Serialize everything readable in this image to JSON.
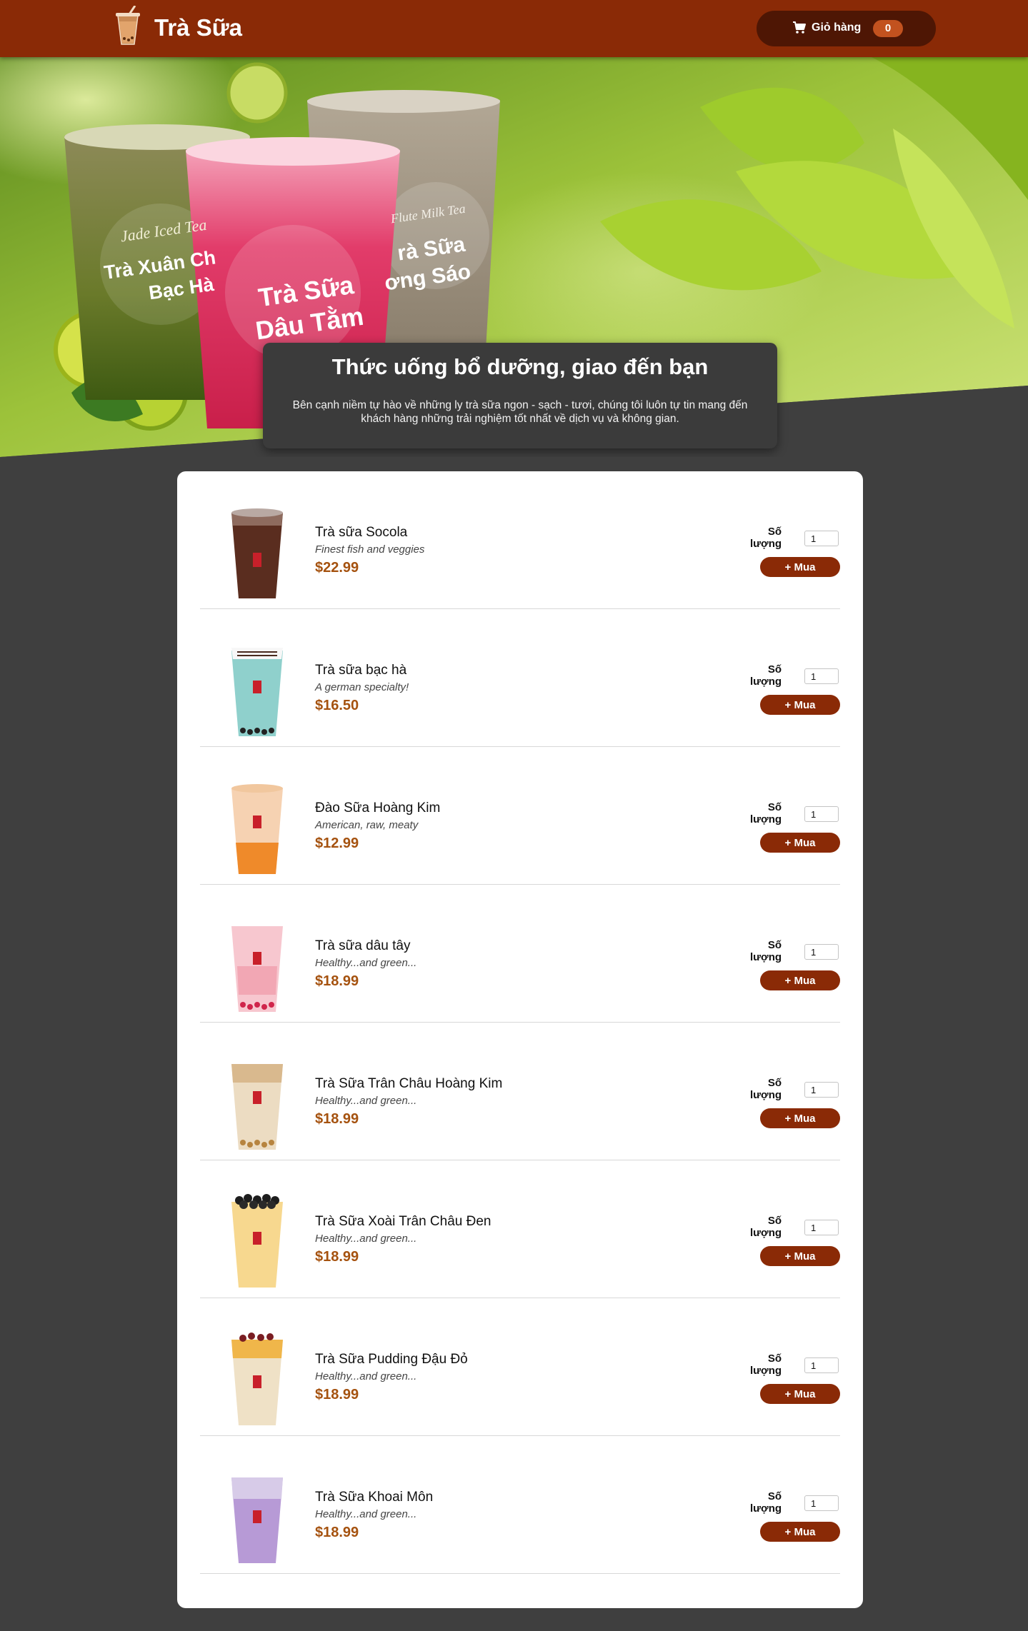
{
  "header": {
    "brand": "Trà Sữa",
    "cart_label": "Giỏ hàng",
    "cart_count": "0"
  },
  "hero": {
    "title": "Thức uống bổ dưỡng, giao đến bạn",
    "description": "Bên cạnh niềm tự hào về những ly trà sữa ngon - sạch - tươi, chúng tôi luôn tự tin mang đến khách hàng những trải nghiệm tốt nhất về dịch vụ và không gian.",
    "image_cups": [
      {
        "line1": "Jade Iced Tea",
        "line2": "Trà Xuân Ch",
        "line3": "Bạc Hà"
      },
      {
        "line1": "Trà Sữa",
        "line2": "Dâu Tằm"
      },
      {
        "line1": "Flute Milk Tea",
        "line2": "rà Sữa",
        "line3": "ơng Sáo"
      }
    ]
  },
  "products": [
    {
      "name": "Trà sữa Socola",
      "desc": "Finest fish and veggies",
      "price": "$22.99",
      "qty_label": "Số lượng",
      "qty": "1",
      "buy_label": "+ Mua",
      "color": "#5a2d1f"
    },
    {
      "name": "Trà sữa bạc hà",
      "desc": "A german specialty!",
      "price": "$16.50",
      "qty_label": "Số lượng",
      "qty": "1",
      "buy_label": "+ Mua",
      "color": "#8fd0cc"
    },
    {
      "name": "Đào Sữa Hoàng Kim",
      "desc": "American, raw, meaty",
      "price": "$12.99",
      "qty_label": "Số lượng",
      "qty": "1",
      "buy_label": "+ Mua",
      "color": "#f0a060"
    },
    {
      "name": "Trà sữa dâu tây",
      "desc": "Healthy...and green...",
      "price": "$18.99",
      "qty_label": "Số lượng",
      "qty": "1",
      "buy_label": "+ Mua",
      "color": "#f3b3bf"
    },
    {
      "name": "Trà Sữa Trân Châu Hoàng Kim",
      "desc": "Healthy...and green...",
      "price": "$18.99",
      "qty_label": "Số lượng",
      "qty": "1",
      "buy_label": "+ Mua",
      "color": "#e8cfa8"
    },
    {
      "name": "Trà Sữa Xoài Trân Châu Đen",
      "desc": "Healthy...and green...",
      "price": "$18.99",
      "qty_label": "Số lượng",
      "qty": "1",
      "buy_label": "+ Mua",
      "color": "#f3cc7a"
    },
    {
      "name": "Trà Sữa Pudding Đậu Đỏ",
      "desc": "Healthy...and green...",
      "price": "$18.99",
      "qty_label": "Số lượng",
      "qty": "1",
      "buy_label": "+ Mua",
      "color": "#f1d49a"
    },
    {
      "name": "Trà Sữa Khoai Môn",
      "desc": "Healthy...and green...",
      "price": "$18.99",
      "qty_label": "Số lượng",
      "qty": "1",
      "buy_label": "+ Mua",
      "color": "#b79ad6"
    }
  ]
}
